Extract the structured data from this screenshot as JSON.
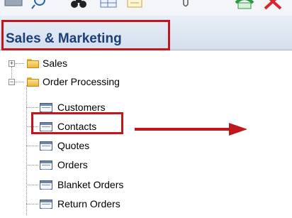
{
  "toolbar": {
    "icons": [
      "print-icon",
      "search-icon",
      "binoculars-icon",
      "grid-icon",
      "list-icon",
      "attachment-icon",
      "refresh-icon",
      "close-icon"
    ]
  },
  "pane": {
    "title": "Sales & Marketing"
  },
  "tree": {
    "groups": [
      {
        "label": "Sales",
        "expanded": false
      },
      {
        "label": "Order Processing",
        "expanded": true
      }
    ],
    "items": [
      "Customers",
      "Contacts",
      "Quotes",
      "Orders",
      "Blanket Orders",
      "Return Orders"
    ],
    "highlighted_item": "Orders"
  },
  "colors": {
    "highlight": "#c0171e",
    "title_text": "#1c3f78"
  }
}
